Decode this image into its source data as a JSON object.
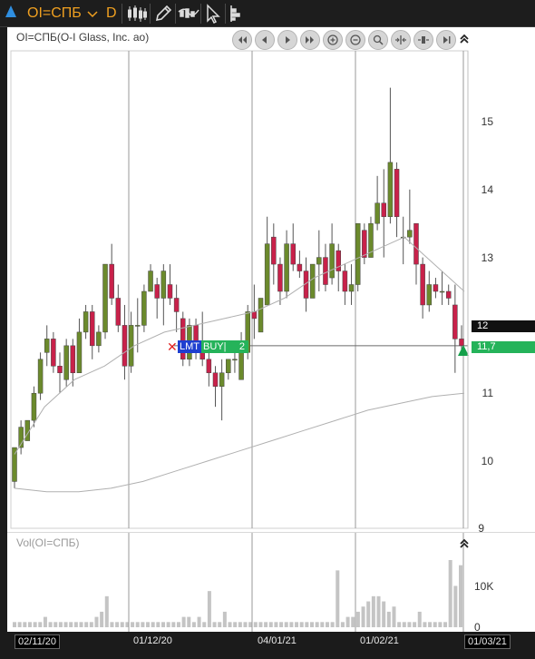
{
  "toolbar": {
    "symbol": "OI=СПБ",
    "period": "D",
    "icons": [
      "candlestick-icon",
      "pencil-icon",
      "indicator-icon",
      "cursor-icon",
      "depth-icon"
    ]
  },
  "chart": {
    "title": "OI=СПБ(O-I Glass, Inc. ао)",
    "volume_title": "Vol(OI=СПБ)",
    "y_ticks": [
      "15",
      "14",
      "13",
      "12",
      "11",
      "10",
      "9"
    ],
    "volume_ticks": [
      "10K",
      "0"
    ],
    "last_price_label": "12",
    "order_price_label": "11,7",
    "order": {
      "type": "LMT",
      "side": "BUY|",
      "qty": "2"
    },
    "x_labels": [
      "02/11/20",
      "01/12/20",
      "04/01/21",
      "01/02/21",
      "01/03/21"
    ],
    "colors": {
      "up": "#6b8a2c",
      "down": "#c8214a",
      "order": "#25b35a",
      "ma": "#b0b0b0"
    }
  },
  "chart_data": {
    "type": "candlestick",
    "ylim": [
      9,
      15.8
    ],
    "candles": [
      [
        9.7,
        10.2,
        9.6,
        10.2
      ],
      [
        10.2,
        10.6,
        10.1,
        10.5
      ],
      [
        10.3,
        10.6,
        10.3,
        10.6
      ],
      [
        10.6,
        11.1,
        10.5,
        11.0
      ],
      [
        11.0,
        11.6,
        10.9,
        11.5
      ],
      [
        11.6,
        12.0,
        11.4,
        11.8
      ],
      [
        11.8,
        11.9,
        11.3,
        11.4
      ],
      [
        11.4,
        11.6,
        11.0,
        11.3
      ],
      [
        11.2,
        11.8,
        11.1,
        11.7
      ],
      [
        11.7,
        11.8,
        11.1,
        11.3
      ],
      [
        11.3,
        12.1,
        11.3,
        11.9
      ],
      [
        11.9,
        12.3,
        11.8,
        12.2
      ],
      [
        12.2,
        12.3,
        11.5,
        11.7
      ],
      [
        11.7,
        12.0,
        11.6,
        11.9
      ],
      [
        11.9,
        12.9,
        11.8,
        12.9
      ],
      [
        12.9,
        13.2,
        12.3,
        12.4
      ],
      [
        12.4,
        12.6,
        11.9,
        12.0
      ],
      [
        12.0,
        12.3,
        11.2,
        11.4
      ],
      [
        11.4,
        12.2,
        11.3,
        12.0
      ],
      [
        12.0,
        12.4,
        11.6,
        12.0
      ],
      [
        12.0,
        12.6,
        11.9,
        12.5
      ],
      [
        12.5,
        12.9,
        12.5,
        12.8
      ],
      [
        12.6,
        12.7,
        12.1,
        12.4
      ],
      [
        12.4,
        12.9,
        12.0,
        12.8
      ],
      [
        12.6,
        12.9,
        12.3,
        12.4
      ],
      [
        12.4,
        12.6,
        11.9,
        12.2
      ],
      [
        12.1,
        12.2,
        11.4,
        11.5
      ],
      [
        11.5,
        12.1,
        11.4,
        12.0
      ],
      [
        12.0,
        12.1,
        11.5,
        11.7
      ],
      [
        11.7,
        12.2,
        11.4,
        11.5
      ],
      [
        11.5,
        11.6,
        11.1,
        11.3
      ],
      [
        11.3,
        11.4,
        10.8,
        11.1
      ],
      [
        11.1,
        11.5,
        10.6,
        11.3
      ],
      [
        11.3,
        11.5,
        11.2,
        11.5
      ],
      [
        11.5,
        11.7,
        11.3,
        11.5
      ],
      [
        11.2,
        11.9,
        11.2,
        11.6
      ],
      [
        11.6,
        12.3,
        11.5,
        12.2
      ],
      [
        12.2,
        12.6,
        11.8,
        12.1
      ],
      [
        11.9,
        12.4,
        11.9,
        12.4
      ],
      [
        12.3,
        13.6,
        12.3,
        13.2
      ],
      [
        13.3,
        13.5,
        12.6,
        12.9
      ],
      [
        12.9,
        13.0,
        12.3,
        12.5
      ],
      [
        12.5,
        13.4,
        12.4,
        13.2
      ],
      [
        13.2,
        13.5,
        12.8,
        12.9
      ],
      [
        12.9,
        13.1,
        12.7,
        12.8
      ],
      [
        12.8,
        13.0,
        12.2,
        12.4
      ],
      [
        12.4,
        12.9,
        12.4,
        12.9
      ],
      [
        12.9,
        13.4,
        12.5,
        13.0
      ],
      [
        13.0,
        13.2,
        12.5,
        12.6
      ],
      [
        12.7,
        13.5,
        12.6,
        13.2
      ],
      [
        13.1,
        13.2,
        12.5,
        12.8
      ],
      [
        12.8,
        12.9,
        12.3,
        12.5
      ],
      [
        12.5,
        12.9,
        12.3,
        12.6
      ],
      [
        12.6,
        13.5,
        12.5,
        13.5
      ],
      [
        13.4,
        13.5,
        12.9,
        13.0
      ],
      [
        13.0,
        13.6,
        13.0,
        13.5
      ],
      [
        13.5,
        14.2,
        13.4,
        13.8
      ],
      [
        13.8,
        14.3,
        13.0,
        13.6
      ],
      [
        13.6,
        15.5,
        13.5,
        14.4
      ],
      [
        14.3,
        14.4,
        13.3,
        13.6
      ],
      [
        13.3,
        13.6,
        12.9,
        13.3
      ],
      [
        13.3,
        14.0,
        13.2,
        13.4
      ],
      [
        13.5,
        13.5,
        12.6,
        12.9
      ],
      [
        12.9,
        13.0,
        12.1,
        12.3
      ],
      [
        12.3,
        12.8,
        12.2,
        12.6
      ],
      [
        12.6,
        12.7,
        12.4,
        12.5
      ],
      [
        12.5,
        12.8,
        12.3,
        12.5
      ],
      [
        12.5,
        12.6,
        12.3,
        12.4
      ],
      [
        12.3,
        12.6,
        11.3,
        11.8
      ],
      [
        11.8,
        12.0,
        11.6,
        11.7
      ]
    ],
    "volume": [
      1,
      1,
      1,
      1,
      1,
      1,
      2,
      1,
      1,
      1,
      1,
      1,
      1,
      1,
      1,
      1,
      2,
      3,
      6,
      1,
      1,
      1,
      1,
      1,
      1,
      1,
      1,
      1,
      1,
      1,
      1,
      1,
      1,
      2,
      2,
      1,
      2,
      1,
      7,
      1,
      1,
      3,
      1,
      1,
      1,
      1,
      1,
      1,
      1,
      1,
      1,
      1,
      1,
      1,
      1,
      1,
      1,
      1,
      1,
      1,
      1,
      1,
      1,
      11,
      1,
      2,
      2,
      3,
      4,
      5,
      6,
      6,
      5,
      3,
      4,
      1,
      1,
      1,
      1,
      3,
      1,
      1,
      1,
      1,
      1,
      13,
      8,
      12
    ],
    "ma_short_approx": [
      10.1,
      10.8,
      11.2,
      11.4,
      11.7,
      11.9,
      12.0,
      12.1,
      12.2,
      12.4,
      12.7,
      12.9,
      13.1,
      13.3,
      12.9,
      12.5
    ],
    "ma_long_approx": [
      9.6,
      9.55,
      9.55,
      9.6,
      9.7,
      9.85,
      10.0,
      10.15,
      10.3,
      10.45,
      10.6,
      10.75,
      10.85,
      10.95,
      11.0
    ]
  }
}
